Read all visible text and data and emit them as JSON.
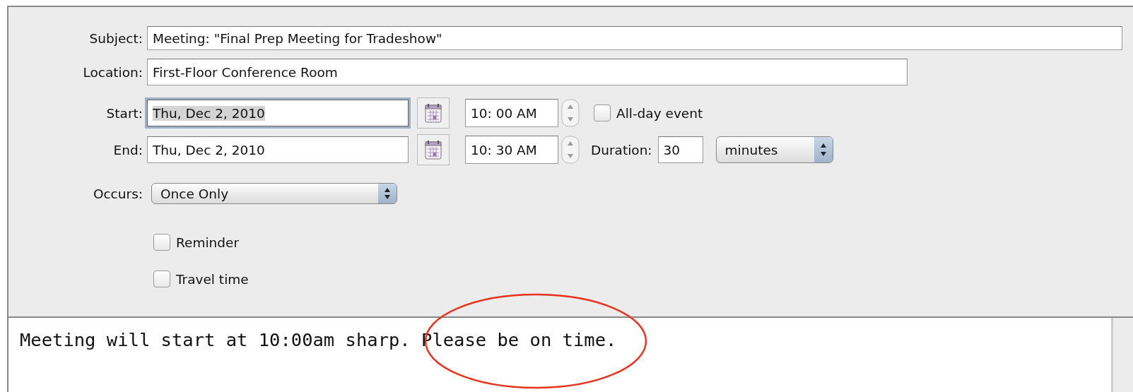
{
  "subject": {
    "label": "Subject:",
    "value": "Meeting: \"Final Prep Meeting for Tradeshow\""
  },
  "location": {
    "label": "Location:",
    "value": "First-Floor Conference Room"
  },
  "start": {
    "label": "Start:",
    "date": "Thu, Dec 2, 2010",
    "focused": true,
    "time": "10: 00 AM"
  },
  "end": {
    "label": "End:",
    "date": "Thu, Dec 2, 2010",
    "focused": false,
    "time": "10: 30 AM"
  },
  "all_day": {
    "label": "All-day event",
    "checked": false
  },
  "duration": {
    "label": "Duration:",
    "value": "30",
    "unit": "minutes"
  },
  "occurs": {
    "label": "Occurs:",
    "value": "Once Only"
  },
  "options": [
    {
      "label": "Reminder",
      "checked": false
    },
    {
      "label": "Travel time",
      "checked": false
    }
  ],
  "notes": "Meeting will start at 10:00am sharp. Please be on time."
}
